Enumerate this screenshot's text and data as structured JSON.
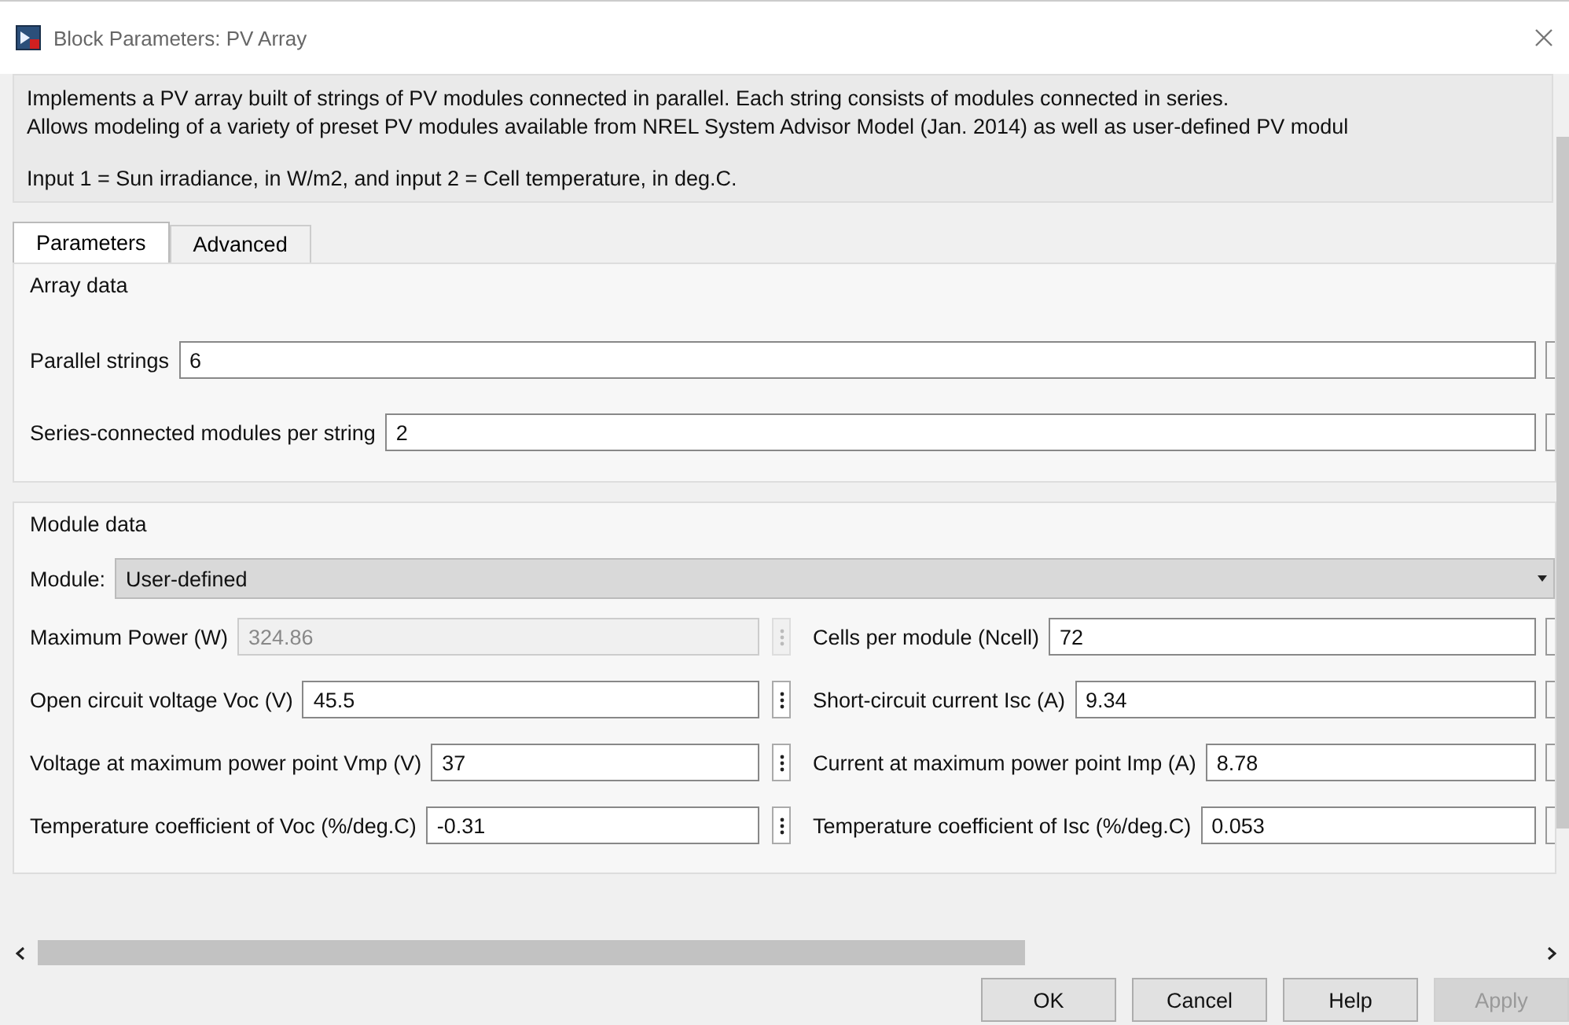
{
  "window": {
    "title": "Block Parameters: PV Array"
  },
  "description": [
    "Implements a PV array built of strings of PV modules connected in parallel. Each string consists of modules connected in series.",
    "Allows modeling of a variety of preset PV modules available from NREL System Advisor Model (Jan. 2014) as well as user-defined PV modul",
    "Input 1 = Sun irradiance, in W/m2, and input 2 = Cell temperature, in deg.C."
  ],
  "tabs": [
    {
      "label": "Parameters",
      "selected": true
    },
    {
      "label": "Advanced",
      "selected": false
    }
  ],
  "array_data": {
    "title": "Array data",
    "fields": [
      {
        "label": "Parallel strings",
        "value": "6"
      },
      {
        "label": "Series-connected modules per string",
        "value": "2"
      }
    ]
  },
  "module_data": {
    "title": "Module data",
    "module": {
      "label": "Module:",
      "value": "User-defined"
    },
    "parameters": [
      {
        "label": "Maximum Power (W)",
        "value": "324.86",
        "disabled": true
      },
      {
        "label": "Cells per module (Ncell)",
        "value": "72",
        "disabled": false
      },
      {
        "label": "Open circuit voltage  Voc (V)",
        "value": "45.5",
        "disabled": false
      },
      {
        "label": "Short-circuit current Isc (A)",
        "value": "9.34",
        "disabled": false
      },
      {
        "label": "Voltage at maximum power point Vmp (V)",
        "value": "37",
        "disabled": false
      },
      {
        "label": "Current at maximum power point Imp (A)",
        "value": "8.78",
        "disabled": false
      },
      {
        "label": "Temperature coefficient of Voc (%/deg.C)",
        "value": "-0.31",
        "disabled": false
      },
      {
        "label": "Temperature coefficient of Isc (%/deg.C)",
        "value": "0.053",
        "disabled": false
      }
    ]
  },
  "buttons": [
    {
      "label": "OK",
      "disabled": false
    },
    {
      "label": "Cancel",
      "disabled": false
    },
    {
      "label": "Help",
      "disabled": false
    },
    {
      "label": "Apply",
      "disabled": true
    }
  ]
}
